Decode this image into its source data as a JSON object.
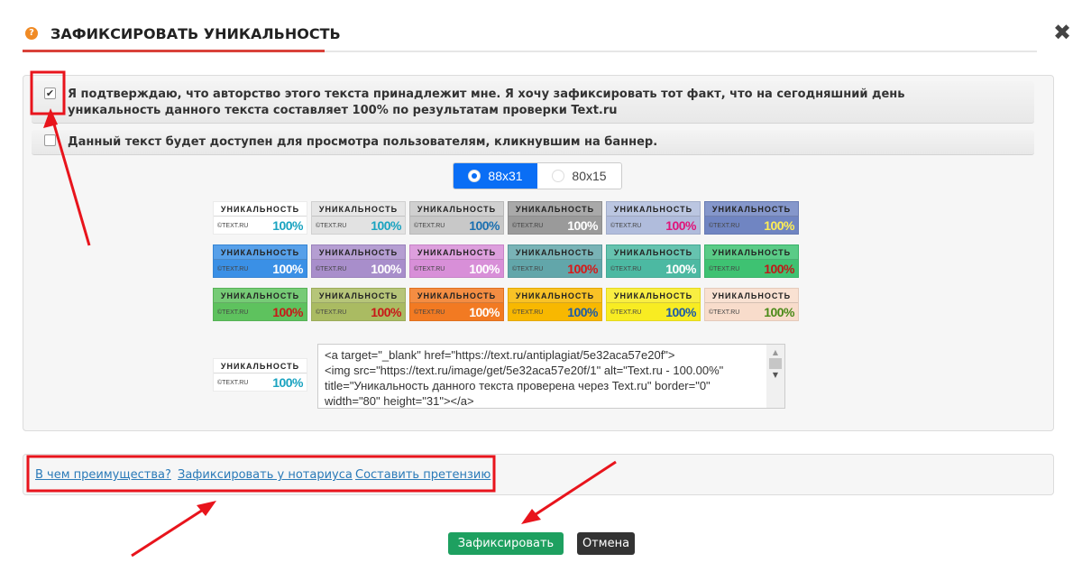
{
  "dialog": {
    "title": "ЗАФИКСИРОВАТЬ УНИКАЛЬНОСТЬ",
    "help_icon": "?",
    "close_icon": "✖"
  },
  "confirm": {
    "checked": true,
    "text": "Я подтверждаю, что авторство этого текста принадлежит мне. Я хочу зафиксировать тот факт, что на сегодняшний день уникальность данного текста составляет 100% по результатам проверки Text.ru"
  },
  "public": {
    "checked": false,
    "text": "Данный текст будет доступен для просмотра пользователям, кликнувшим на баннер."
  },
  "size_options": [
    {
      "label": "88x31",
      "selected": true
    },
    {
      "label": "80x15",
      "selected": false
    }
  ],
  "banner": {
    "title": "УНИКАЛЬНОСТЬ",
    "source": "©TEXT.RU",
    "percent": "100%"
  },
  "banners": [
    {
      "bg": "#ffffff",
      "pct": "#1aa3c0"
    },
    {
      "bg": "#e2e2e2",
      "pct": "#1aa3c0"
    },
    {
      "bg": "#c8c8c8",
      "pct": "#1a6fb0"
    },
    {
      "bg": "#9a9a9a",
      "pct": "#ffffff"
    },
    {
      "bg": "#b0bcdc",
      "pct": "#e0147a"
    },
    {
      "bg": "#7085c2",
      "pct": "#ffee55"
    },
    {
      "bg": "#3a90e6",
      "pct": "#ffffff"
    },
    {
      "bg": "#a88ecb",
      "pct": "#ffffff"
    },
    {
      "bg": "#d88fd8",
      "pct": "#ffffff"
    },
    {
      "bg": "#62a6aa",
      "pct": "#d81818"
    },
    {
      "bg": "#4cb9a2",
      "pct": "#ffffff"
    },
    {
      "bg": "#3ec272",
      "pct": "#c01818"
    },
    {
      "bg": "#5ec25e",
      "pct": "#c81818"
    },
    {
      "bg": "#aabb62",
      "pct": "#c81818"
    },
    {
      "bg": "#f27a22",
      "pct": "#ffffff"
    },
    {
      "bg": "#f8b800",
      "pct": "#1a5aa8"
    },
    {
      "bg": "#f8ec22",
      "pct": "#1a5aa8"
    },
    {
      "bg": "#f8dccb",
      "pct": "#4a8a18"
    }
  ],
  "code": "<a target=\"_blank\" href=\"https://text.ru/antiplagiat/5e32aca57e20f\">\n<img src=\"https://text.ru/image/get/5e32aca57e20f/1\" alt=\"Text.ru - 100.00%\" title=\"Уникальность данного текста проверена через Text.ru\" border=\"0\" width=\"80\" height=\"31\"></a>",
  "links": [
    "В чем преимущества?",
    "Зафиксировать у нотариуса",
    "Составить претензию"
  ],
  "buttons": {
    "submit": "Зафиксировать",
    "cancel": "Отмена"
  },
  "colors": {
    "accent": "#d9423a",
    "primary": "#0a6ef5",
    "submit": "#1ea060",
    "annotation": "#e8141c"
  }
}
